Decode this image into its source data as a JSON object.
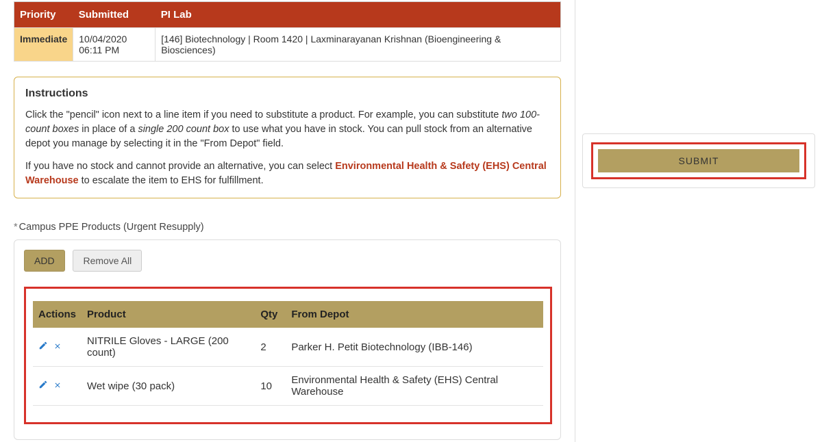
{
  "summary": {
    "headers": {
      "priority": "Priority",
      "submitted": "Submitted",
      "pi_lab": "PI Lab"
    },
    "row": {
      "priority": "Immediate",
      "submitted": "10/04/2020 06:11 PM",
      "pi_lab": "[146] Biotechnology | Room 1420 | Laxminarayanan Krishnan (Bioengineering & Biosciences)"
    }
  },
  "instructions": {
    "heading": "Instructions",
    "p1_a": "Click the \"pencil\" icon next to a line item if you need to substitute a product. For example, you can substitute ",
    "p1_em1": "two 100-count boxes",
    "p1_b": " in place of a ",
    "p1_em2": "single 200 count box",
    "p1_c": " to use what you have in stock. You can pull stock from an alternative depot you manage by selecting it in the \"From Depot\" field.",
    "p2_a": "If you have no stock and cannot provide an alternative, you can select ",
    "p2_strong": "Environmental Health & Safety (EHS) Central Warehouse",
    "p2_b": " to escalate the item to EHS for fulfillment."
  },
  "section_heading": "Campus PPE Products (Urgent Resupply)",
  "buttons": {
    "add": "ADD",
    "remove_all": "Remove All"
  },
  "products": {
    "headers": {
      "actions": "Actions",
      "product": "Product",
      "qty": "Qty",
      "from_depot": "From Depot"
    },
    "rows": [
      {
        "product": "NITRILE Gloves - LARGE (200 count)",
        "qty": "2",
        "from_depot": "Parker H. Petit Biotechnology (IBB-146)"
      },
      {
        "product": "Wet wipe (30 pack)",
        "qty": "10",
        "from_depot": "Environmental Health & Safety (EHS) Central Warehouse"
      }
    ]
  },
  "submit_label": "SUBMIT"
}
